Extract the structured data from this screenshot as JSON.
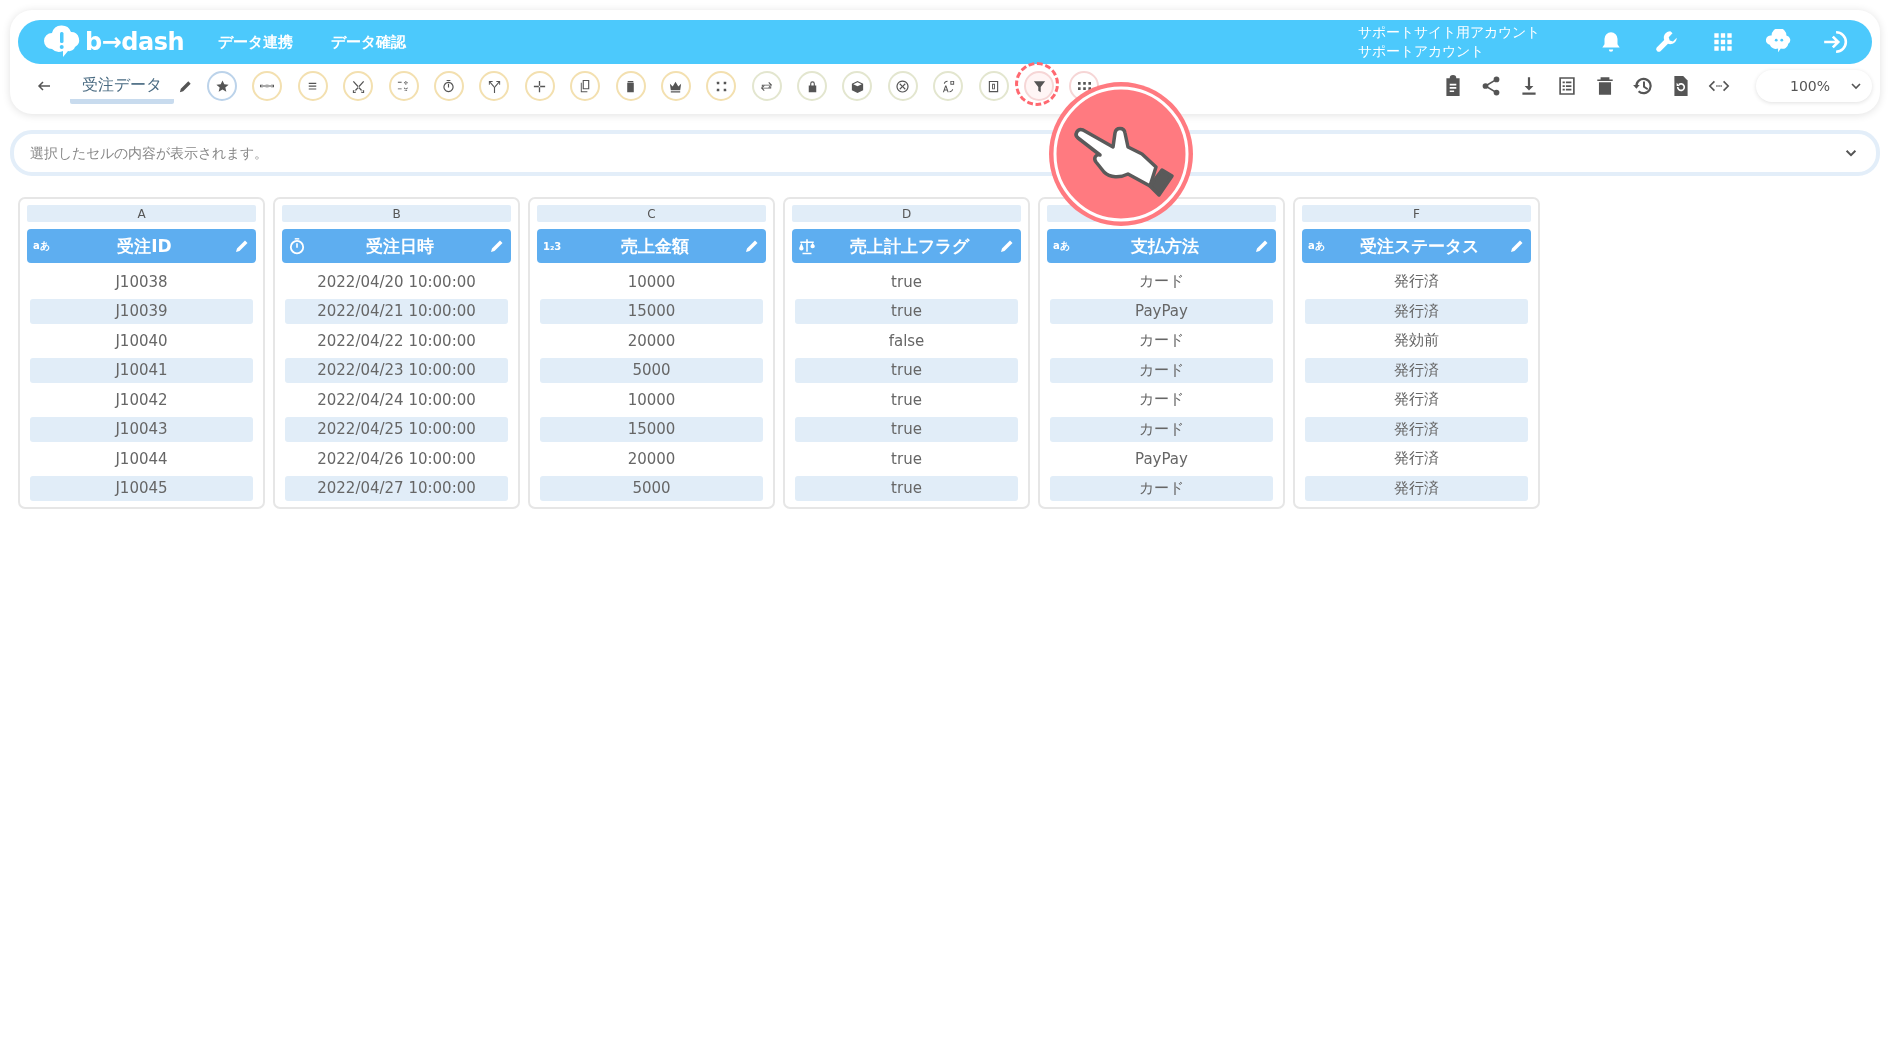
{
  "header": {
    "logo_text": "b→dash",
    "nav": [
      "データ連携",
      "データ確認"
    ],
    "account": [
      "サポートサイト用アカウント",
      "サポートアカウント"
    ]
  },
  "toolbar": {
    "title": "受注データ",
    "zoom": "100%",
    "tools": [
      {
        "kind": "star",
        "highlighted": false
      },
      {
        "kind": "dots",
        "highlighted": false
      },
      {
        "kind": "lines",
        "highlighted": false
      },
      {
        "kind": "scissors",
        "highlighted": false
      },
      {
        "kind": "calc",
        "highlighted": false
      },
      {
        "kind": "timer",
        "highlighted": false
      },
      {
        "kind": "split",
        "highlighted": false
      },
      {
        "kind": "plus",
        "highlighted": false
      },
      {
        "kind": "copy",
        "highlighted": false
      },
      {
        "kind": "trash",
        "highlighted": false
      },
      {
        "kind": "crown",
        "highlighted": false
      },
      {
        "kind": "collapse",
        "highlighted": false
      },
      {
        "kind": "repeat",
        "highlighted": false
      },
      {
        "kind": "lock",
        "highlighted": false
      },
      {
        "kind": "box",
        "highlighted": false
      },
      {
        "kind": "cancel",
        "highlighted": false
      },
      {
        "kind": "translate",
        "highlighted": false
      },
      {
        "kind": "zero",
        "highlighted": false
      },
      {
        "kind": "filter",
        "highlighted": true
      },
      {
        "kind": "grid",
        "highlighted": false
      }
    ]
  },
  "formula_bar": {
    "placeholder": "選択したセルの内容が表示されます。"
  },
  "columns": [
    {
      "letter": "A",
      "kind": "text",
      "type_label": "aあ",
      "name": "受注ID",
      "cells": [
        "J10038",
        "J10039",
        "J10040",
        "J10041",
        "J10042",
        "J10043",
        "J10044",
        "J10045"
      ]
    },
    {
      "letter": "B",
      "kind": "datetime",
      "name": "受注日時",
      "cells": [
        "2022/04/20 10:00:00",
        "2022/04/21 10:00:00",
        "2022/04/22 10:00:00",
        "2022/04/23 10:00:00",
        "2022/04/24 10:00:00",
        "2022/04/25 10:00:00",
        "2022/04/26 10:00:00",
        "2022/04/27 10:00:00"
      ]
    },
    {
      "letter": "C",
      "kind": "number",
      "type_label": "1₂3",
      "name": "売上金額",
      "cells": [
        "10000",
        "15000",
        "20000",
        "5000",
        "10000",
        "15000",
        "20000",
        "5000"
      ]
    },
    {
      "letter": "D",
      "kind": "boolean",
      "name": "売上計上フラグ",
      "cells": [
        "true",
        "true",
        "false",
        "true",
        "true",
        "true",
        "true",
        "true"
      ]
    },
    {
      "kind": "text",
      "type_label": "aあ",
      "name": "支払方法",
      "cells": [
        "カード",
        "PayPay",
        "カード",
        "カード",
        "カード",
        "カード",
        "PayPay",
        "カード"
      ]
    },
    {
      "letter": "F",
      "kind": "text",
      "type_label": "aあ",
      "name": "受注ステータス",
      "cells": [
        "発行済",
        "発行済",
        "発効前",
        "発行済",
        "発行済",
        "発行済",
        "発行済",
        "発行済"
      ]
    }
  ]
}
